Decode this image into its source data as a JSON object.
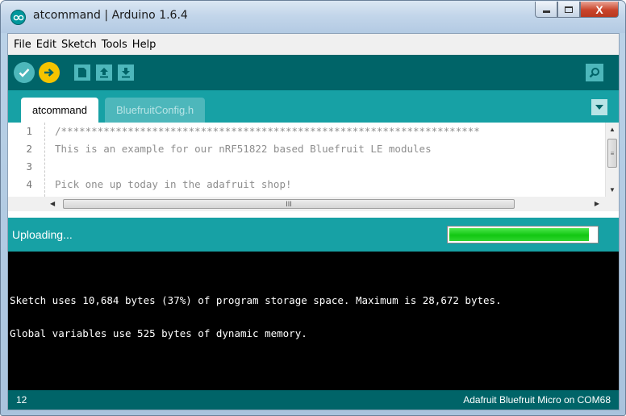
{
  "window": {
    "title": "atcommand | Arduino 1.6.4",
    "controls": {
      "minimize_icon": "minimize-icon",
      "maximize_icon": "maximize-icon",
      "close_label": "X"
    }
  },
  "menubar": {
    "items": [
      "File",
      "Edit",
      "Sketch",
      "Tools",
      "Help"
    ]
  },
  "toolbar": {
    "buttons": [
      {
        "name": "verify",
        "icon": "checkmark-icon",
        "color": "#4db7bb"
      },
      {
        "name": "upload",
        "icon": "arrow-right-icon",
        "color": "#f5c400"
      },
      {
        "name": "new",
        "icon": "document-icon",
        "color": "#4db7bb"
      },
      {
        "name": "open",
        "icon": "arrow-up-icon",
        "color": "#4db7bb"
      },
      {
        "name": "save",
        "icon": "arrow-down-icon",
        "color": "#4db7bb"
      },
      {
        "name": "serial-monitor",
        "icon": "magnifier-icon",
        "color": "#4db7bb"
      }
    ]
  },
  "tabs": [
    {
      "label": "atcommand",
      "active": true
    },
    {
      "label": "BluefruitConfig.h",
      "active": false
    }
  ],
  "editor": {
    "lines": [
      {
        "num": "1",
        "text": "/*********************************************************************"
      },
      {
        "num": "2",
        "text": "This is an example for our nRF51822 based Bluefruit LE modules"
      },
      {
        "num": "3",
        "text": ""
      },
      {
        "num": "4",
        "text": "Pick one up today in the adafruit shop!"
      }
    ],
    "hscroll_grip": "III",
    "vscroll_grip": "≡"
  },
  "status": {
    "text": "Uploading...",
    "progress_fraction": 0.95
  },
  "console": {
    "lines": [
      "Sketch uses 10,684 bytes (37%) of program storage space. Maximum is 28,672 bytes.",
      "Global variables use 525 bytes of dynamic memory."
    ]
  },
  "footer": {
    "line_number": "12",
    "board": "Adafruit Bluefruit Micro on COM68"
  },
  "colors": {
    "toolbar_bg": "#006468",
    "tabs_bg": "#17a1a5",
    "console_bg": "#000000",
    "progress_green": "#12c712"
  }
}
